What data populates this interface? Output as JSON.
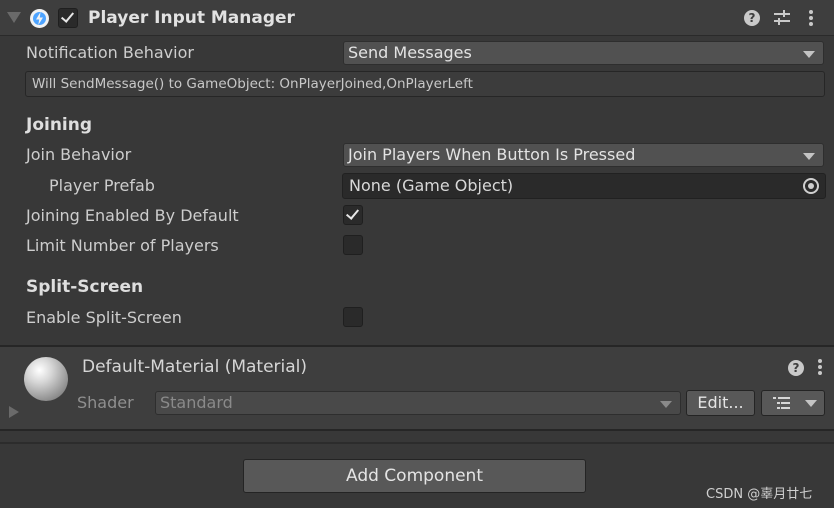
{
  "component": {
    "title": "Player Input Manager",
    "enabled": true,
    "icons": [
      "help-icon",
      "presets-icon",
      "more-icon"
    ]
  },
  "notification": {
    "label": "Notification Behavior",
    "value": "Send Messages",
    "info": "Will SendMessage() to GameObject: OnPlayerJoined,OnPlayerLeft"
  },
  "joining": {
    "section_title": "Joining",
    "join_behavior_label": "Join Behavior",
    "join_behavior_value": "Join Players When Button Is Pressed",
    "player_prefab_label": "Player Prefab",
    "player_prefab_value": "None (Game Object)",
    "joining_enabled_label": "Joining Enabled By Default",
    "joining_enabled_checked": true,
    "limit_players_label": "Limit Number of Players",
    "limit_players_checked": false
  },
  "split_screen": {
    "section_title": "Split-Screen",
    "enable_label": "Enable Split-Screen",
    "enable_checked": false
  },
  "material": {
    "title": "Default-Material (Material)",
    "shader_label": "Shader",
    "shader_value": "Standard",
    "edit_label": "Edit..."
  },
  "footer": {
    "add_component_label": "Add Component"
  },
  "watermark": "CSDN @辜月廿七",
  "colors": {
    "background": "#383838",
    "header": "#3e3e3e",
    "dropdown": "#515151",
    "field_dark": "#2a2a2a",
    "text": "#d2d2d2"
  }
}
